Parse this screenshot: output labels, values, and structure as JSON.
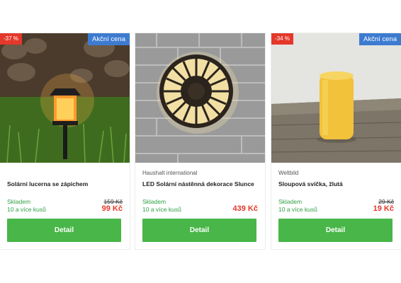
{
  "products": [
    {
      "discount_badge": "-37 %",
      "sale_badge": "Akční cena",
      "brand": "",
      "name": "Solární lucerna se zápichem",
      "stock_status": "Skladem",
      "stock_qty": "10 a více kusů",
      "old_price": "159 Kč",
      "price": "99 Kč",
      "button_label": "Detail"
    },
    {
      "discount_badge": "",
      "sale_badge": "",
      "brand": "Haushalt international",
      "name": "LED Solární nástěnná dekorace Slunce",
      "stock_status": "Skladem",
      "stock_qty": "10 a více kusů",
      "old_price": "",
      "price": "439 Kč",
      "button_label": "Detail"
    },
    {
      "discount_badge": "-34 %",
      "sale_badge": "Akční cena",
      "brand": "Weltbild",
      "name": "Sloupová svíčka, žlutá",
      "stock_status": "Skladem",
      "stock_qty": "10 a více kusů",
      "old_price": "29 Kč",
      "price": "19 Kč",
      "button_label": "Detail"
    }
  ],
  "colors": {
    "discount_badge": "#e4382b",
    "sale_badge": "#3d7bd1",
    "stock": "#2ea043",
    "price": "#e4382b",
    "button": "#48b648"
  }
}
